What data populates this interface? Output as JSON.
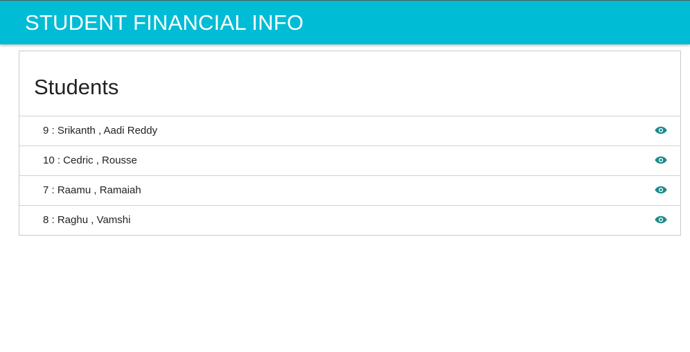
{
  "header": {
    "title": "STUDENT FINANCIAL INFO",
    "background": "#00bcd4"
  },
  "panel": {
    "title": "Students"
  },
  "students": [
    {
      "label": "9 : Srikanth , Aadi Reddy",
      "action_icon": "eye-icon"
    },
    {
      "label": "10 : Cedric , Rousse",
      "action_icon": "eye-icon"
    },
    {
      "label": "7 : Raamu , Ramaiah",
      "action_icon": "eye-icon"
    },
    {
      "label": "8 : Raghu , Vamshi",
      "action_icon": "eye-icon"
    }
  ],
  "colors": {
    "accent": "#00bcd4",
    "icon": "#1a8a8a"
  }
}
